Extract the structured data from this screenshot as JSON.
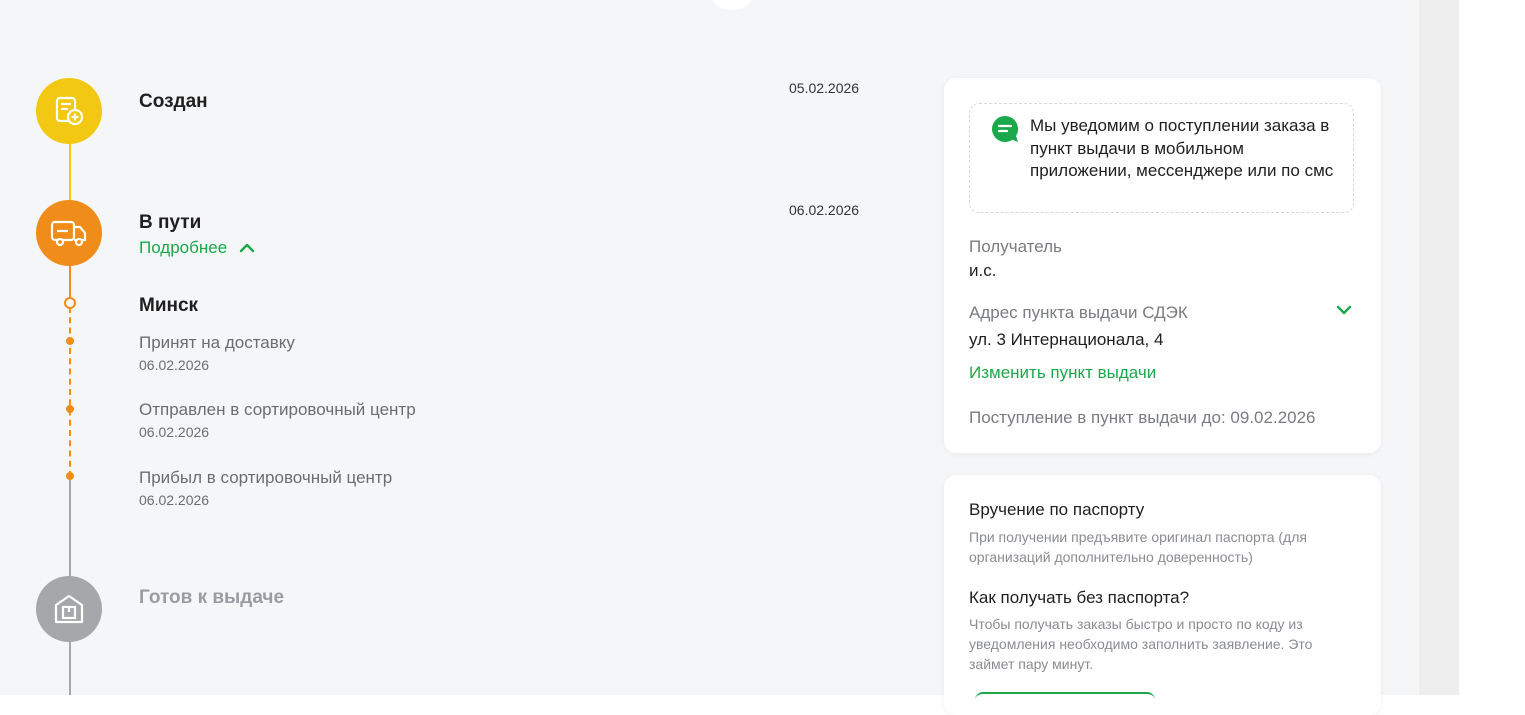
{
  "colors": {
    "accent_green": "#1ba84b",
    "created_yellow": "#f3c813",
    "transit_orange": "#f08d1a",
    "ready_gray": "#a6a7ab",
    "background": "#f5f6f8"
  },
  "timeline": {
    "steps": [
      {
        "title": "Создан",
        "date": "05.02.2026",
        "icon": "document-add-icon"
      },
      {
        "title": "В пути",
        "date": "06.02.2026",
        "icon": "truck-icon",
        "more_label": "Подробнее"
      },
      {
        "title": "Готов к выдаче",
        "icon": "warehouse-box-icon"
      }
    ],
    "transit_details": {
      "city": "Минск",
      "events": [
        {
          "text": "Принят на доставку",
          "date": "06.02.2026"
        },
        {
          "text": "Отправлен в сортировочный центр",
          "date": "06.02.2026"
        },
        {
          "text": "Прибыл в сортировочный центр",
          "date": "06.02.2026"
        }
      ]
    }
  },
  "delivery_card": {
    "notice_icon": "chat-bubble-icon",
    "notice": "Мы уведомим о поступлении заказа в пункт выдачи в мобильном приложении, мессенджере или по смс",
    "recipient_label": "Получатель",
    "recipient_value": "и.с.",
    "address_label": "Адрес пункта выдачи СДЭК",
    "address_value": "ул. 3 Интернационала, 4",
    "change_link": "Изменить пункт выдачи",
    "arrival": "Поступление в пункт выдачи до: 09.02.2026"
  },
  "passport_card": {
    "title": "Вручение по паспорту",
    "text": "При получении предъявите оригинал паспорта (для организаций дополнительно доверенность)",
    "no_passport_title": "Как получать без паспорта?",
    "no_passport_text": "Чтобы получать заказы быстро и просто по коду из уведомления необходимо заполнить заявление. Это займет пару минут."
  }
}
